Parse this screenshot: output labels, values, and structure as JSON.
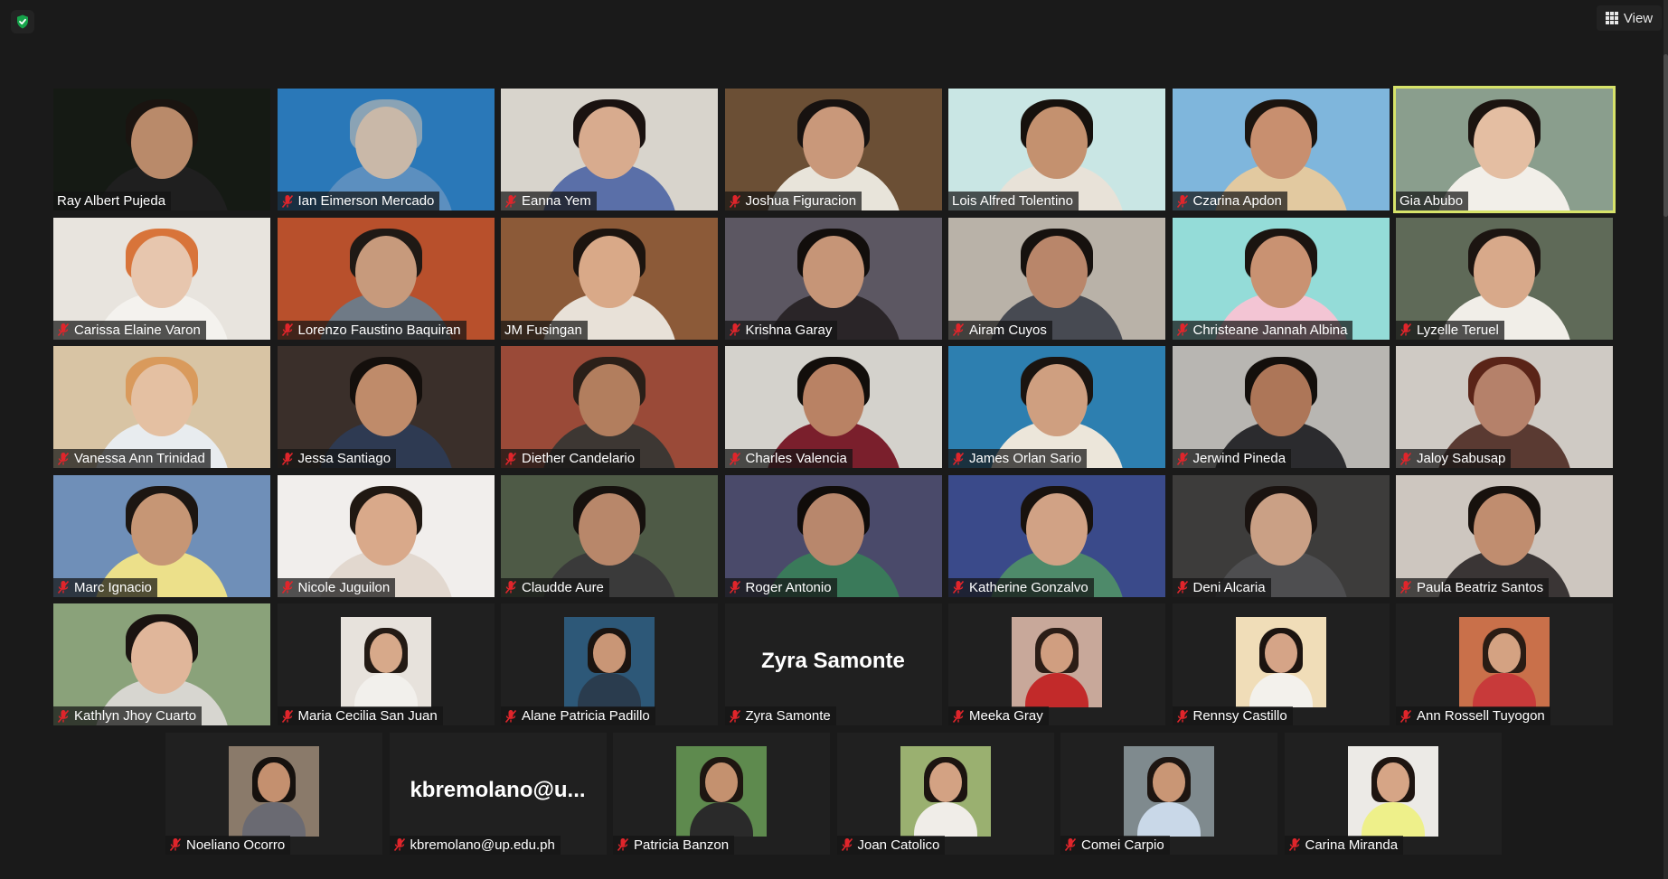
{
  "app": {
    "view_label": "View",
    "icons": {
      "security": "shield-check-icon",
      "view": "grid-icon",
      "muted": "mic-off-icon"
    },
    "colors": {
      "background": "#1a1a1a",
      "speaking_border": "#d7e36a",
      "muted_mic": "#e0252b",
      "security": "#16a34a"
    }
  },
  "participants": [
    {
      "name": "Ray Albert Pujeda",
      "muted": false,
      "type": "video",
      "bg": "#151a14",
      "skin": "#b98a6a",
      "hair": "#1a1410",
      "shirt": "#1f1f1f"
    },
    {
      "name": "Ian Eimerson Mercado",
      "muted": true,
      "type": "video",
      "bg": "#2a78b8",
      "skin": "#c9b8a8",
      "hair": "#8aa3b5",
      "shirt": "#5c8fbf"
    },
    {
      "name": "Eanna Yem",
      "muted": true,
      "type": "video",
      "bg": "#d8d4cc",
      "skin": "#d8ab8e",
      "hair": "#1a1210",
      "shirt": "#5a6fa8"
    },
    {
      "name": "Joshua Figuracion",
      "muted": true,
      "type": "video",
      "bg": "#6b4f35",
      "skin": "#c9987a",
      "hair": "#171210",
      "shirt": "#e8e4da"
    },
    {
      "name": "Lois Alfred Tolentino",
      "muted": false,
      "type": "video",
      "bg": "#c9e6e4",
      "skin": "#c4916f",
      "hair": "#16110d",
      "shirt": "#e8e2d8"
    },
    {
      "name": "Czarina Apdon",
      "muted": true,
      "type": "video",
      "bg": "#7fb6dc",
      "skin": "#c88f6f",
      "hair": "#1b140f",
      "shirt": "#e2c9a0"
    },
    {
      "name": "Gia Abubo",
      "muted": false,
      "type": "video",
      "speaking": true,
      "bg": "#8a9e8d",
      "skin": "#e4bea2",
      "hair": "#1b1410",
      "shirt": "#f2efe9"
    },
    {
      "name": "Carissa Elaine Varon",
      "muted": true,
      "type": "video",
      "bg": "#e8e4de",
      "skin": "#e7c6ae",
      "hair": "#d8743a",
      "shirt": "#f4f2ee"
    },
    {
      "name": "Lorenzo Faustino Baquiran",
      "muted": true,
      "type": "video",
      "bg": "#b8502c",
      "skin": "#c79a7c",
      "hair": "#1f1915",
      "shirt": "#6f7a86"
    },
    {
      "name": "JM Fusingan",
      "muted": false,
      "type": "video",
      "bg": "#8c5a38",
      "skin": "#d9a988",
      "hair": "#1c140f",
      "shirt": "#e8e1d8"
    },
    {
      "name": "Krishna Garay",
      "muted": true,
      "type": "video",
      "bg": "#5c5762",
      "skin": "#c69577",
      "hair": "#120e0c",
      "shirt": "#2a2528"
    },
    {
      "name": "Airam Cuyos",
      "muted": true,
      "type": "video",
      "bg": "#b9b2a8",
      "skin": "#b9866a",
      "hair": "#16110e",
      "shirt": "#474a52"
    },
    {
      "name": "Christeane Jannah Albina",
      "muted": true,
      "type": "video",
      "bg": "#94dcd8",
      "skin": "#c99272",
      "hair": "#1b1410",
      "shirt": "#f3c5d4"
    },
    {
      "name": "Lyzelle Teruel",
      "muted": true,
      "type": "video",
      "bg": "#5f6a58",
      "skin": "#d8a98a",
      "hair": "#1c1511",
      "shirt": "#f1eee8"
    },
    {
      "name": "Vanessa Ann Trinidad",
      "muted": true,
      "type": "video",
      "bg": "#d8c4a4",
      "skin": "#e4c0a2",
      "hair": "#d99a5c",
      "shirt": "#e8ecef"
    },
    {
      "name": "Jessa Santiago",
      "muted": true,
      "type": "video",
      "bg": "#3a2f2a",
      "skin": "#bf8b6a",
      "hair": "#140f0c",
      "shirt": "#2e3a52"
    },
    {
      "name": "Diether Candelario",
      "muted": true,
      "type": "video",
      "bg": "#9a4a38",
      "skin": "#b27e5e",
      "hair": "#2a1f18",
      "shirt": "#3d3733"
    },
    {
      "name": "Charles Valencia",
      "muted": true,
      "type": "video",
      "bg": "#d4d2cc",
      "skin": "#b98264",
      "hair": "#120e0b",
      "shirt": "#7a1f2c"
    },
    {
      "name": "James Orlan Sario",
      "muted": true,
      "type": "video",
      "bg": "#2d7fb0",
      "skin": "#cf9f80",
      "hair": "#1a1410",
      "shirt": "#ece6da"
    },
    {
      "name": "Jerwind Pineda",
      "muted": true,
      "type": "video",
      "bg": "#b8b6b2",
      "skin": "#ad7658",
      "hair": "#130f0c",
      "shirt": "#2b2b2e"
    },
    {
      "name": "Jaloy Sabusap",
      "muted": true,
      "type": "video",
      "bg": "#cfcac4",
      "skin": "#b5816a",
      "hair": "#5a2418",
      "shirt": "#5a3a32"
    },
    {
      "name": "Marc Ignacio",
      "muted": true,
      "type": "video",
      "bg": "#6f8fb8",
      "skin": "#c69675",
      "hair": "#1c1612",
      "shirt": "#ece08a"
    },
    {
      "name": "Nicole Juguilon",
      "muted": true,
      "type": "video",
      "bg": "#f1eeec",
      "skin": "#d9a98a",
      "hair": "#201812",
      "shirt": "#e2d8cf"
    },
    {
      "name": "Claudde Aure",
      "muted": true,
      "type": "video",
      "bg": "#4e5a46",
      "skin": "#b8876a",
      "hair": "#16110e",
      "shirt": "#3a3a3a"
    },
    {
      "name": "Roger Antonio",
      "muted": true,
      "type": "video",
      "bg": "#4a4a6a",
      "skin": "#b8876c",
      "hair": "#100c0a",
      "shirt": "#3a7a5a"
    },
    {
      "name": "Katherine Gonzalvo",
      "muted": true,
      "type": "video",
      "bg": "#3a4a8a",
      "skin": "#d1a285",
      "hair": "#18120e",
      "shirt": "#4e8a6a"
    },
    {
      "name": "Deni Alcaria",
      "muted": true,
      "type": "video",
      "bg": "#3d3c3b",
      "skin": "#caa085",
      "hair": "#1a1310",
      "shirt": "#4e4e50"
    },
    {
      "name": "Paula Beatriz Santos",
      "muted": true,
      "type": "video",
      "bg": "#cdc6bf",
      "skin": "#c08d6f",
      "hair": "#17110d",
      "shirt": "#3a3535"
    },
    {
      "name": "Kathlyn Jhoy Cuarto",
      "muted": true,
      "type": "video",
      "bg": "#8aa27a",
      "skin": "#e0b69a",
      "hair": "#1a1310",
      "shirt": "#d7d6d0"
    },
    {
      "name": "Maria Cecilia San Juan",
      "muted": true,
      "type": "photo",
      "bg": "#e7e2dc",
      "skin": "#d7a98a",
      "hair": "#231a14",
      "shirt": "#f2f0ec"
    },
    {
      "name": "Alane Patricia Padillo",
      "muted": true,
      "type": "photo",
      "bg": "#2d5878",
      "skin": "#c99676",
      "hair": "#1b1410",
      "shirt": "#2a3c4e"
    },
    {
      "name": "Zyra Samonte",
      "muted": true,
      "type": "name",
      "display": "Zyra Samonte"
    },
    {
      "name": "Meeka Gray",
      "muted": true,
      "type": "photo",
      "bg": "#c8a89a",
      "skin": "#d09e80",
      "hair": "#2b1d16",
      "shirt": "#c22a2a"
    },
    {
      "name": "Rennsy Castillo",
      "muted": true,
      "type": "photo",
      "bg": "#f0ddb8",
      "skin": "#d5a487",
      "hair": "#1c1410",
      "shirt": "#f3f1ec"
    },
    {
      "name": "Ann Rossell Tuyogon",
      "muted": true,
      "type": "photo",
      "bg": "#c9704a",
      "skin": "#d4a282",
      "hair": "#2a1c14",
      "shirt": "#c83a3a"
    },
    {
      "name": "Noeliano Ocorro",
      "muted": true,
      "type": "photo",
      "bg": "#8a7a6a",
      "skin": "#c4906f",
      "hair": "#16110e",
      "shirt": "#6a6a72"
    },
    {
      "name": "kbremolano@up.edu.ph",
      "muted": true,
      "type": "name",
      "display": "kbremolano@u..."
    },
    {
      "name": "Patricia Banzon",
      "muted": true,
      "type": "photo",
      "bg": "#5e8a4e",
      "skin": "#c4916f",
      "hair": "#1e1611",
      "shirt": "#2a2a2a"
    },
    {
      "name": "Joan Catolico",
      "muted": true,
      "type": "photo",
      "bg": "#9ab070",
      "skin": "#d3a283",
      "hair": "#1c1410",
      "shirt": "#f0ede8"
    },
    {
      "name": "Comei Carpio",
      "muted": true,
      "type": "photo",
      "bg": "#7f8a8e",
      "skin": "#c99675",
      "hair": "#1d1511",
      "shirt": "#c9d8e8"
    },
    {
      "name": "Carina Miranda",
      "muted": true,
      "type": "photo",
      "bg": "#eceae6",
      "skin": "#d6a586",
      "hair": "#1e1511",
      "shirt": "#eef08a"
    }
  ]
}
